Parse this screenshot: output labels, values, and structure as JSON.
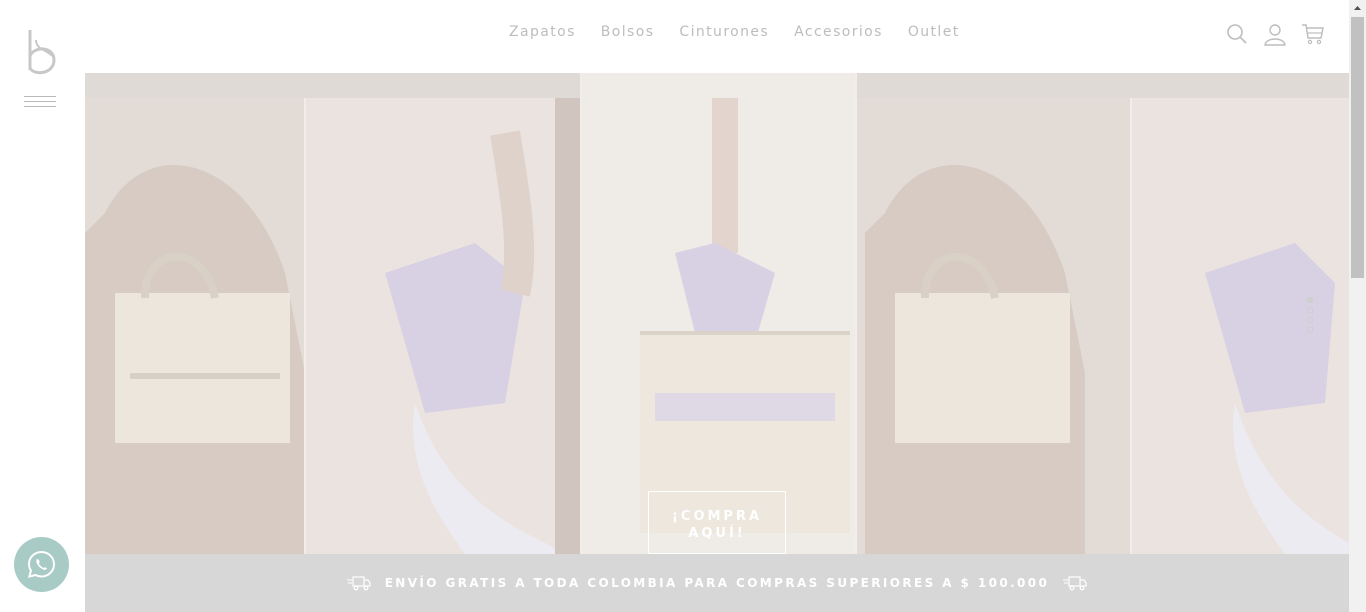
{
  "brand": {
    "logo_letter": "b"
  },
  "nav": {
    "items": [
      {
        "label": "Zapatos"
      },
      {
        "label": "Bolsos"
      },
      {
        "label": "Cinturones"
      },
      {
        "label": "Accesorios"
      },
      {
        "label": "Outlet"
      }
    ]
  },
  "header_icons": [
    "search-icon",
    "user-icon",
    "cart-icon"
  ],
  "hero": {
    "cta_line1": "¡COMPRA",
    "cta_line2": "AQUÍ!",
    "slide_count": 4,
    "active_slide": 1
  },
  "shipping_bar": {
    "text": "ENVÍO GRATIS A TODA COLOMBIA PARA COMPRAS SUPERIORES A $ 100.000"
  },
  "colors": {
    "nav_text": "#bdbdbd",
    "ship_bar_bg": "#d7d7d7",
    "whatsapp_bg": "#a9cbc6"
  }
}
